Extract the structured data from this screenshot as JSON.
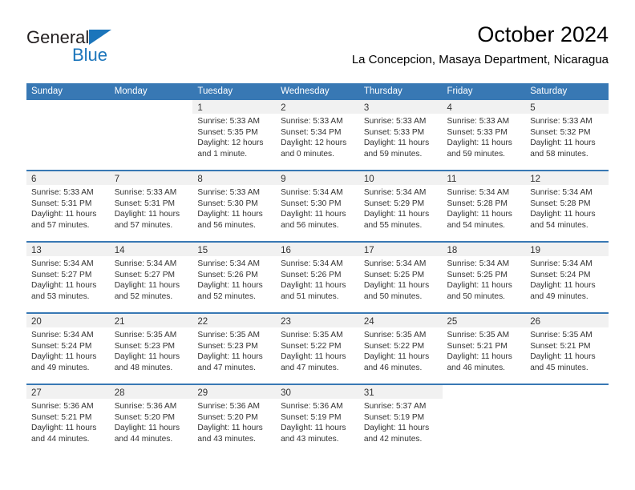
{
  "brand": {
    "name_top": "General",
    "name_bottom": "Blue",
    "accent_color": "#1b75bb"
  },
  "header": {
    "title": "October 2024",
    "subtitle": "La Concepcion, Masaya Department, Nicaragua"
  },
  "calendar": {
    "header_bg": "#3878b4",
    "daynum_bg": "#f1f1f1",
    "weekdays": [
      "Sunday",
      "Monday",
      "Tuesday",
      "Wednesday",
      "Thursday",
      "Friday",
      "Saturday"
    ],
    "weeks": [
      [
        {
          "day": "",
          "sunrise": "",
          "sunset": "",
          "daylight_line1": "",
          "daylight_line2": ""
        },
        {
          "day": "",
          "sunrise": "",
          "sunset": "",
          "daylight_line1": "",
          "daylight_line2": ""
        },
        {
          "day": "1",
          "sunrise": "Sunrise: 5:33 AM",
          "sunset": "Sunset: 5:35 PM",
          "daylight_line1": "Daylight: 12 hours",
          "daylight_line2": "and 1 minute."
        },
        {
          "day": "2",
          "sunrise": "Sunrise: 5:33 AM",
          "sunset": "Sunset: 5:34 PM",
          "daylight_line1": "Daylight: 12 hours",
          "daylight_line2": "and 0 minutes."
        },
        {
          "day": "3",
          "sunrise": "Sunrise: 5:33 AM",
          "sunset": "Sunset: 5:33 PM",
          "daylight_line1": "Daylight: 11 hours",
          "daylight_line2": "and 59 minutes."
        },
        {
          "day": "4",
          "sunrise": "Sunrise: 5:33 AM",
          "sunset": "Sunset: 5:33 PM",
          "daylight_line1": "Daylight: 11 hours",
          "daylight_line2": "and 59 minutes."
        },
        {
          "day": "5",
          "sunrise": "Sunrise: 5:33 AM",
          "sunset": "Sunset: 5:32 PM",
          "daylight_line1": "Daylight: 11 hours",
          "daylight_line2": "and 58 minutes."
        }
      ],
      [
        {
          "day": "6",
          "sunrise": "Sunrise: 5:33 AM",
          "sunset": "Sunset: 5:31 PM",
          "daylight_line1": "Daylight: 11 hours",
          "daylight_line2": "and 57 minutes."
        },
        {
          "day": "7",
          "sunrise": "Sunrise: 5:33 AM",
          "sunset": "Sunset: 5:31 PM",
          "daylight_line1": "Daylight: 11 hours",
          "daylight_line2": "and 57 minutes."
        },
        {
          "day": "8",
          "sunrise": "Sunrise: 5:33 AM",
          "sunset": "Sunset: 5:30 PM",
          "daylight_line1": "Daylight: 11 hours",
          "daylight_line2": "and 56 minutes."
        },
        {
          "day": "9",
          "sunrise": "Sunrise: 5:34 AM",
          "sunset": "Sunset: 5:30 PM",
          "daylight_line1": "Daylight: 11 hours",
          "daylight_line2": "and 56 minutes."
        },
        {
          "day": "10",
          "sunrise": "Sunrise: 5:34 AM",
          "sunset": "Sunset: 5:29 PM",
          "daylight_line1": "Daylight: 11 hours",
          "daylight_line2": "and 55 minutes."
        },
        {
          "day": "11",
          "sunrise": "Sunrise: 5:34 AM",
          "sunset": "Sunset: 5:28 PM",
          "daylight_line1": "Daylight: 11 hours",
          "daylight_line2": "and 54 minutes."
        },
        {
          "day": "12",
          "sunrise": "Sunrise: 5:34 AM",
          "sunset": "Sunset: 5:28 PM",
          "daylight_line1": "Daylight: 11 hours",
          "daylight_line2": "and 54 minutes."
        }
      ],
      [
        {
          "day": "13",
          "sunrise": "Sunrise: 5:34 AM",
          "sunset": "Sunset: 5:27 PM",
          "daylight_line1": "Daylight: 11 hours",
          "daylight_line2": "and 53 minutes."
        },
        {
          "day": "14",
          "sunrise": "Sunrise: 5:34 AM",
          "sunset": "Sunset: 5:27 PM",
          "daylight_line1": "Daylight: 11 hours",
          "daylight_line2": "and 52 minutes."
        },
        {
          "day": "15",
          "sunrise": "Sunrise: 5:34 AM",
          "sunset": "Sunset: 5:26 PM",
          "daylight_line1": "Daylight: 11 hours",
          "daylight_line2": "and 52 minutes."
        },
        {
          "day": "16",
          "sunrise": "Sunrise: 5:34 AM",
          "sunset": "Sunset: 5:26 PM",
          "daylight_line1": "Daylight: 11 hours",
          "daylight_line2": "and 51 minutes."
        },
        {
          "day": "17",
          "sunrise": "Sunrise: 5:34 AM",
          "sunset": "Sunset: 5:25 PM",
          "daylight_line1": "Daylight: 11 hours",
          "daylight_line2": "and 50 minutes."
        },
        {
          "day": "18",
          "sunrise": "Sunrise: 5:34 AM",
          "sunset": "Sunset: 5:25 PM",
          "daylight_line1": "Daylight: 11 hours",
          "daylight_line2": "and 50 minutes."
        },
        {
          "day": "19",
          "sunrise": "Sunrise: 5:34 AM",
          "sunset": "Sunset: 5:24 PM",
          "daylight_line1": "Daylight: 11 hours",
          "daylight_line2": "and 49 minutes."
        }
      ],
      [
        {
          "day": "20",
          "sunrise": "Sunrise: 5:34 AM",
          "sunset": "Sunset: 5:24 PM",
          "daylight_line1": "Daylight: 11 hours",
          "daylight_line2": "and 49 minutes."
        },
        {
          "day": "21",
          "sunrise": "Sunrise: 5:35 AM",
          "sunset": "Sunset: 5:23 PM",
          "daylight_line1": "Daylight: 11 hours",
          "daylight_line2": "and 48 minutes."
        },
        {
          "day": "22",
          "sunrise": "Sunrise: 5:35 AM",
          "sunset": "Sunset: 5:23 PM",
          "daylight_line1": "Daylight: 11 hours",
          "daylight_line2": "and 47 minutes."
        },
        {
          "day": "23",
          "sunrise": "Sunrise: 5:35 AM",
          "sunset": "Sunset: 5:22 PM",
          "daylight_line1": "Daylight: 11 hours",
          "daylight_line2": "and 47 minutes."
        },
        {
          "day": "24",
          "sunrise": "Sunrise: 5:35 AM",
          "sunset": "Sunset: 5:22 PM",
          "daylight_line1": "Daylight: 11 hours",
          "daylight_line2": "and 46 minutes."
        },
        {
          "day": "25",
          "sunrise": "Sunrise: 5:35 AM",
          "sunset": "Sunset: 5:21 PM",
          "daylight_line1": "Daylight: 11 hours",
          "daylight_line2": "and 46 minutes."
        },
        {
          "day": "26",
          "sunrise": "Sunrise: 5:35 AM",
          "sunset": "Sunset: 5:21 PM",
          "daylight_line1": "Daylight: 11 hours",
          "daylight_line2": "and 45 minutes."
        }
      ],
      [
        {
          "day": "27",
          "sunrise": "Sunrise: 5:36 AM",
          "sunset": "Sunset: 5:21 PM",
          "daylight_line1": "Daylight: 11 hours",
          "daylight_line2": "and 44 minutes."
        },
        {
          "day": "28",
          "sunrise": "Sunrise: 5:36 AM",
          "sunset": "Sunset: 5:20 PM",
          "daylight_line1": "Daylight: 11 hours",
          "daylight_line2": "and 44 minutes."
        },
        {
          "day": "29",
          "sunrise": "Sunrise: 5:36 AM",
          "sunset": "Sunset: 5:20 PM",
          "daylight_line1": "Daylight: 11 hours",
          "daylight_line2": "and 43 minutes."
        },
        {
          "day": "30",
          "sunrise": "Sunrise: 5:36 AM",
          "sunset": "Sunset: 5:19 PM",
          "daylight_line1": "Daylight: 11 hours",
          "daylight_line2": "and 43 minutes."
        },
        {
          "day": "31",
          "sunrise": "Sunrise: 5:37 AM",
          "sunset": "Sunset: 5:19 PM",
          "daylight_line1": "Daylight: 11 hours",
          "daylight_line2": "and 42 minutes."
        },
        {
          "day": "",
          "sunrise": "",
          "sunset": "",
          "daylight_line1": "",
          "daylight_line2": ""
        },
        {
          "day": "",
          "sunrise": "",
          "sunset": "",
          "daylight_line1": "",
          "daylight_line2": ""
        }
      ]
    ]
  }
}
